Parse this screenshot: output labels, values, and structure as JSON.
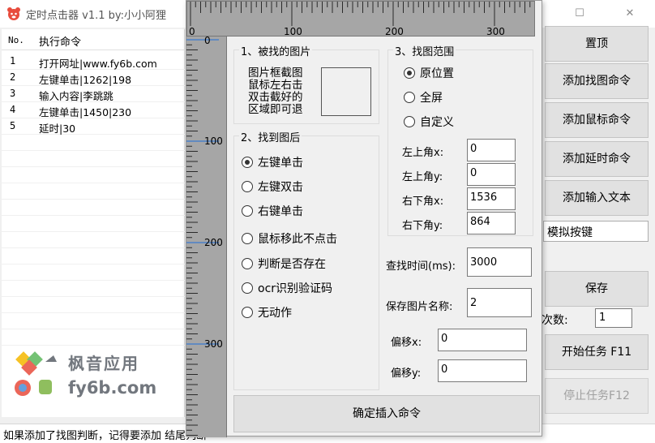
{
  "window": {
    "title": "定时点击器 v1.1 by:小小阿狸",
    "minimize": "—",
    "maximize": "☐",
    "close": "✕"
  },
  "list": {
    "headers": {
      "no": "No.",
      "command": "执行命令"
    },
    "rows": [
      {
        "no": "1",
        "command": "打开网址|www.fy6b.com"
      },
      {
        "no": "2",
        "command": "左键单击|1262|198"
      },
      {
        "no": "3",
        "command": "输入内容|李跳跳"
      },
      {
        "no": "4",
        "command": "左键单击|1450|230"
      },
      {
        "no": "5",
        "command": "延时|30"
      }
    ]
  },
  "watermark": {
    "top": "枫音应用",
    "bottom": "fy6b.com"
  },
  "status": {
    "text": "如果添加了找图判断，记得要添加 结尾判断"
  },
  "buttons": {
    "pin": "置顶",
    "add_find_image": "添加找图命令",
    "add_mouse": "添加鼠标命令",
    "add_delay": "添加延时命令",
    "add_input": "添加输入文本",
    "simulate_select": "模拟按键",
    "save": "保存",
    "count_label": "次数:",
    "count_value": "1",
    "start": "开始任务 F11",
    "stop": "停止任务F12"
  },
  "dialog": {
    "ruler_top": [
      "0",
      "100",
      "200",
      "300"
    ],
    "ruler_left": [
      "0",
      "100",
      "200",
      "300"
    ],
    "group1": {
      "title": "1、被找的图片",
      "hint": "图片框截图 鼠标左右击 双击截好的 区域即可退"
    },
    "group2": {
      "title": "2、找到图后",
      "options": [
        "左键单击",
        "左键双击",
        "右键单击",
        "鼠标移此不点击",
        "判断是否存在",
        "ocr识别验证码",
        "无动作"
      ],
      "selected": 0
    },
    "group3": {
      "title": "3、找图范围",
      "options": [
        "原位置",
        "全屏",
        "自定义"
      ],
      "selected": 0,
      "fields": [
        {
          "label": "左上角x:",
          "value": "0"
        },
        {
          "label": "左上角y:",
          "value": "0"
        },
        {
          "label": "右下角x:",
          "value": "1536"
        },
        {
          "label": "右下角y:",
          "value": "864"
        }
      ]
    },
    "search_time": {
      "label": "查找时间(ms):",
      "value": "3000"
    },
    "save_name": {
      "label": "保存图片名称:",
      "value": "2"
    },
    "offset_x": {
      "label": "偏移x:",
      "value": "0"
    },
    "offset_y": {
      "label": "偏移y:",
      "value": "0"
    },
    "confirm": "确定插入命令"
  }
}
